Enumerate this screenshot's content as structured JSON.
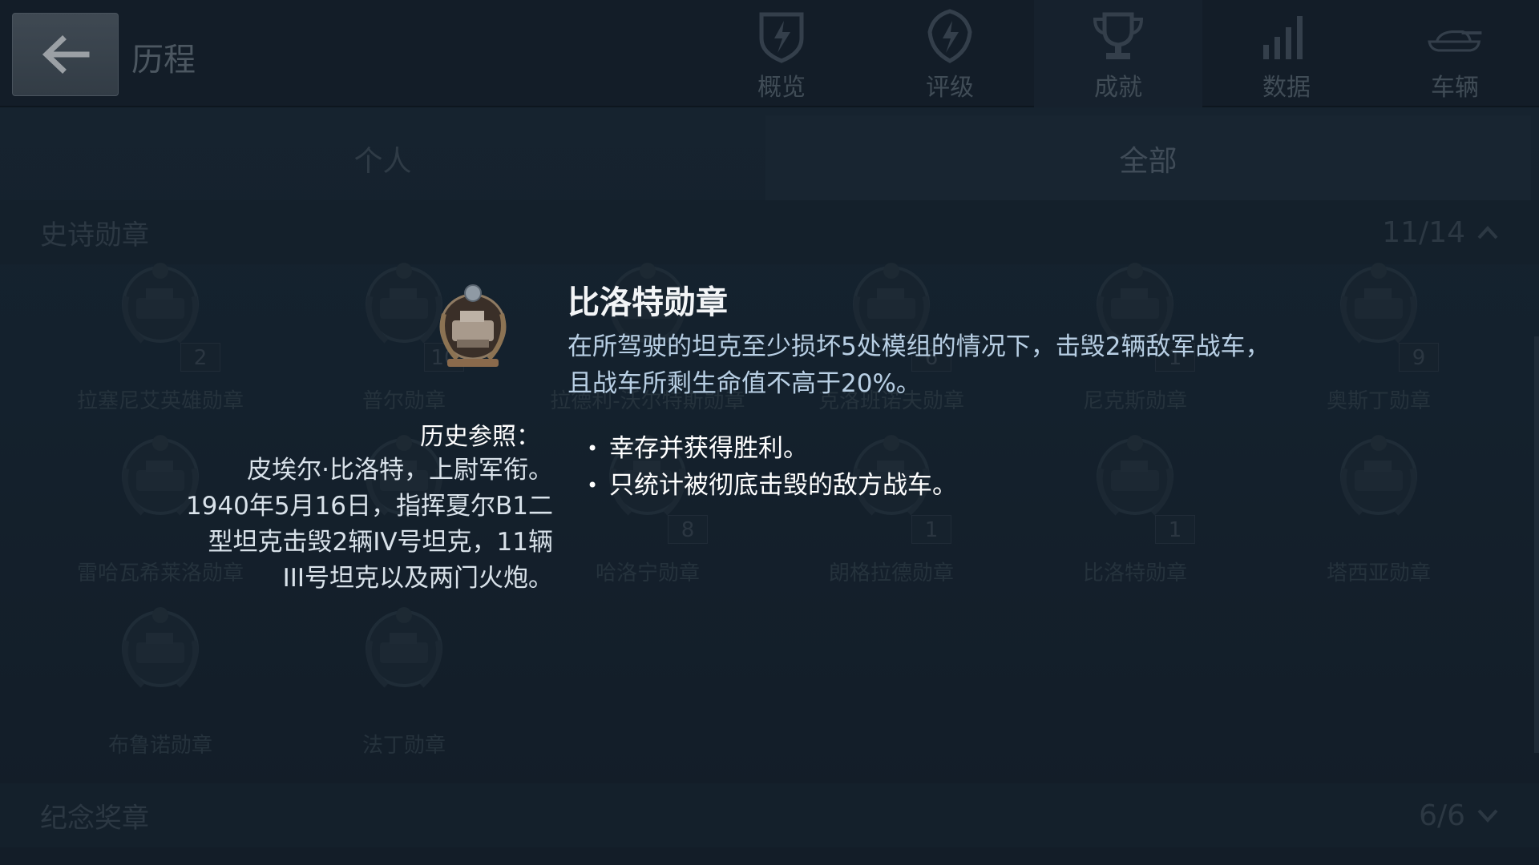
{
  "header": {
    "title": "历程",
    "nav": [
      {
        "label": "概览",
        "icon": "shield-lightning-icon"
      },
      {
        "label": "评级",
        "icon": "rating-badge-icon"
      },
      {
        "label": "成就",
        "icon": "trophy-icon",
        "active": true
      },
      {
        "label": "数据",
        "icon": "bar-chart-icon"
      },
      {
        "label": "车辆",
        "icon": "tank-icon"
      }
    ]
  },
  "subtabs": [
    {
      "label": "个人"
    },
    {
      "label": "全部",
      "active": true
    }
  ],
  "section_epic": {
    "name": "史诗勋章",
    "count": "11/14"
  },
  "section_commem": {
    "name": "纪念奖章",
    "count": "6/6"
  },
  "medals": [
    {
      "name": "拉塞尼艾英雄勋章",
      "count": "2"
    },
    {
      "name": "普尔勋章",
      "count": "10"
    },
    {
      "name": "拉德利-沃尔特斯勋章",
      "count": ""
    },
    {
      "name": "克洛班诺夫勋章",
      "count": "6"
    },
    {
      "name": "尼克斯勋章",
      "count": "1"
    },
    {
      "name": "奥斯丁勋章",
      "count": "9"
    },
    {
      "name": "雷哈瓦希莱洛勋章",
      "count": ""
    },
    {
      "name": "",
      "count": ""
    },
    {
      "name": "哈洛宁勋章",
      "count": "8"
    },
    {
      "name": "朗格拉德勋章",
      "count": "1"
    },
    {
      "name": "比洛特勋章",
      "count": "1"
    },
    {
      "name": "塔西亚勋章",
      "count": ""
    },
    {
      "name": "布鲁诺勋章",
      "count": ""
    },
    {
      "name": "法丁勋章",
      "count": ""
    }
  ],
  "tooltip": {
    "title": "比洛特勋章",
    "desc_line1": "在所驾驶的坦克至少损坏5处模组的情况下，击毁2辆敌军战车，",
    "desc_line2": "且战车所剩生命值不高于20%。",
    "history_label": "历史参照：",
    "history_lines": [
      "皮埃尔·比洛特，上尉军衔。",
      "1940年5月16日，指挥夏尔B1二",
      "型坦克击毁2辆IV号坦克，11辆",
      "III号坦克以及两门火炮。"
    ],
    "bullets": [
      "幸存并获得胜利。",
      "只统计被彻底击毁的敌方战车。"
    ]
  }
}
